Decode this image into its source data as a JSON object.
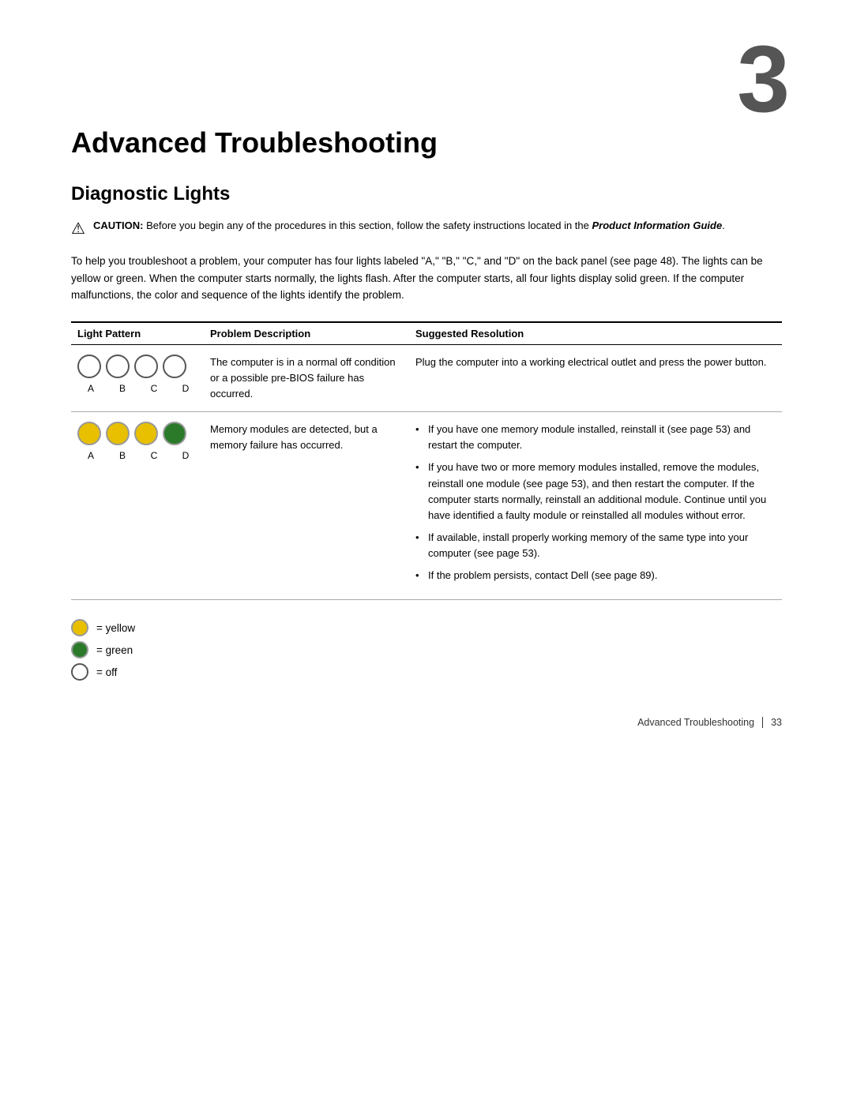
{
  "chapter": {
    "number": "3",
    "title": "Advanced Troubleshooting",
    "section": "Diagnostic Lights"
  },
  "caution": {
    "label": "CAUTION:",
    "text": "Before you begin any of the procedures in this section, follow the safety instructions located in the",
    "guide": "Product Information Guide",
    "period": "."
  },
  "body_text": "To help you troubleshoot a problem, your computer has four lights labeled \"A,\" \"B,\" \"C,\" and \"D\" on the back panel (see page 48). The lights can be yellow or green. When the computer starts normally, the lights flash. After the computer starts, all four lights display solid green. If the computer malfunctions, the color and sequence of the lights identify the problem.",
  "table": {
    "headers": [
      "Light Pattern",
      "Problem Description",
      "Suggested Resolution"
    ],
    "rows": [
      {
        "lights": [
          "off",
          "off",
          "off",
          "off"
        ],
        "labels": [
          "A",
          "B",
          "C",
          "D"
        ],
        "problem": "The computer is in a normal off condition or a possible pre-BIOS failure has occurred.",
        "resolution_simple": "Plug the computer into a working electrical outlet and press the power button.",
        "resolution_bullets": []
      },
      {
        "lights": [
          "yellow",
          "yellow",
          "yellow",
          "green"
        ],
        "labels": [
          "A",
          "B",
          "C",
          "D"
        ],
        "problem": "Memory modules are detected, but a memory failure has occurred.",
        "resolution_simple": "",
        "resolution_bullets": [
          "If you have one memory module installed, reinstall it (see page 53) and restart the computer.",
          "If you have two or more memory modules installed, remove the modules, reinstall one module (see page 53), and then restart the computer. If the computer starts normally, reinstall an additional module. Continue until you have identified a faulty module or reinstalled all modules without error.",
          "If available, install properly working memory of the same type into your computer (see page 53).",
          "If the problem persists, contact Dell (see page 89)."
        ]
      }
    ]
  },
  "legend": {
    "items": [
      {
        "color": "yellow",
        "label": "= yellow"
      },
      {
        "color": "green",
        "label": "= green"
      },
      {
        "color": "off",
        "label": "= off"
      }
    ]
  },
  "footer": {
    "text": "Advanced Troubleshooting",
    "page": "33"
  }
}
